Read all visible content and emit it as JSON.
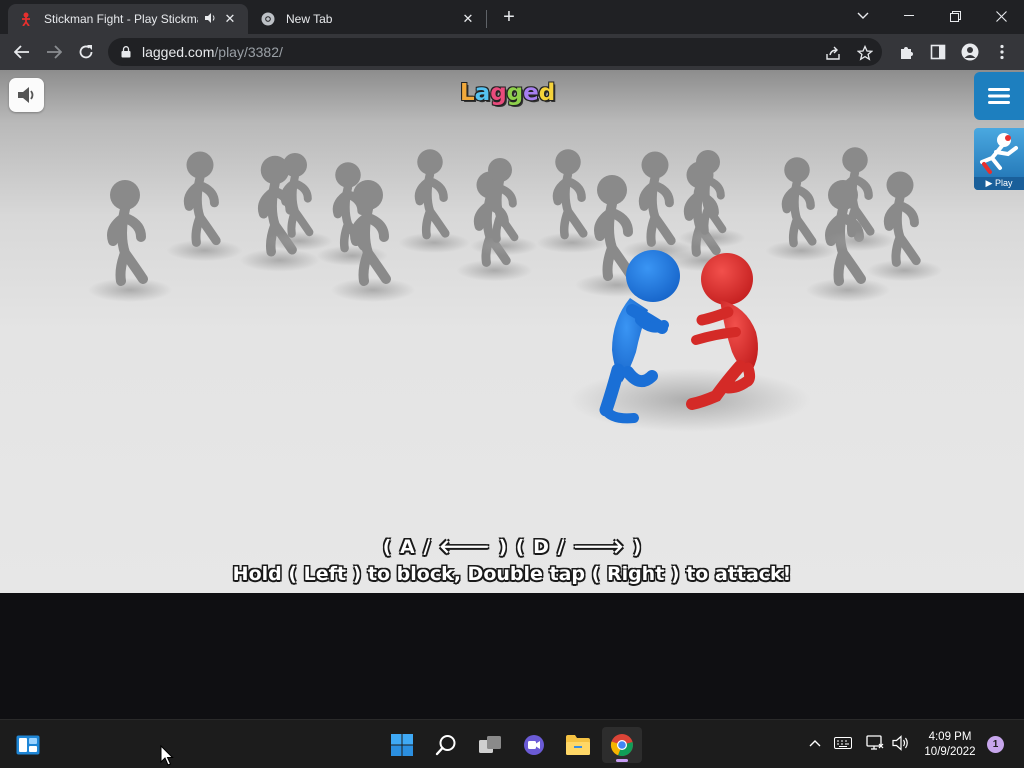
{
  "browser": {
    "tabs": [
      {
        "title": "Stickman Fight - Play Stickman",
        "audio_icon": "speaker-icon",
        "active": true
      },
      {
        "title": "New Tab",
        "active": false
      }
    ],
    "close_label": "✕",
    "new_tab_label": "+",
    "window_controls": {
      "dropdown": "⌄",
      "minimize": "—",
      "restore": "❐",
      "close": "✕"
    },
    "url_host": "lagged.com",
    "url_path": "/play/3382/"
  },
  "game": {
    "logo_letters": [
      {
        "ch": "L",
        "color": "#f2a93b"
      },
      {
        "ch": "a",
        "color": "#55c2f0"
      },
      {
        "ch": "g",
        "color": "#e94b7c"
      },
      {
        "ch": "g",
        "color": "#8ed04b"
      },
      {
        "ch": "e",
        "color": "#a77ff0"
      },
      {
        "ch": "d",
        "color": "#f5d33b"
      }
    ],
    "play_label": "▶ Play",
    "keys_line": "( A / 🡐 )     ( D / 🡒 )",
    "hint_line": "Hold ( Left ) to block, Double tap ( Right ) to attack!",
    "fighter_colors": {
      "blue": "#1f7ee8",
      "red": "#e8302e",
      "crowd": "#8a8a8a"
    }
  },
  "taskbar": {
    "time": "4:09 PM",
    "date": "10/9/2022",
    "notifications": "1"
  }
}
